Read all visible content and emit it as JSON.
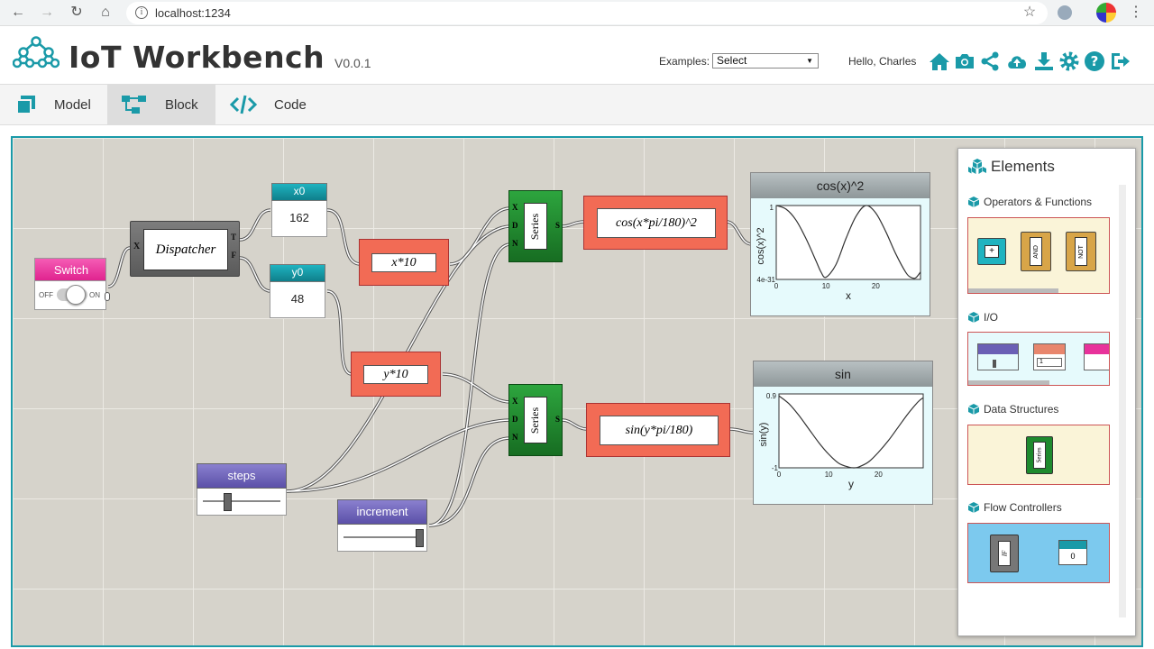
{
  "browser": {
    "url": "localhost:1234"
  },
  "header": {
    "title": "IoT Workbench",
    "version": "V0.0.1",
    "examples_label": "Examples:",
    "examples_selected": "Select",
    "greeting": "Hello, Charles"
  },
  "tabs": [
    {
      "label": "Model",
      "active": false
    },
    {
      "label": "Block",
      "active": true
    },
    {
      "label": "Code",
      "active": false
    }
  ],
  "nodes": {
    "switch": {
      "title": "Switch",
      "off": "OFF",
      "on": "ON"
    },
    "dispatcher": {
      "label": "Dispatcher",
      "in": "X",
      "out_t": "T",
      "out_f": "F"
    },
    "x0": {
      "title": "x0",
      "value": "162"
    },
    "y0": {
      "title": "y0",
      "value": "48"
    },
    "x10": {
      "expr": "x*10"
    },
    "y10": {
      "expr": "y*10"
    },
    "series1": {
      "label": "Series",
      "in_x": "X",
      "in_d": "D",
      "in_n": "N",
      "out": "S"
    },
    "series2": {
      "label": "Series",
      "in_x": "X",
      "in_d": "D",
      "in_n": "N",
      "out": "S"
    },
    "cosexpr": {
      "expr": "cos(x*pi/180)^2"
    },
    "sinexpr": {
      "expr": "sin(y*pi/180)"
    },
    "steps": {
      "title": "steps"
    },
    "increment": {
      "title": "increment"
    }
  },
  "charts_labels": {
    "cos": {
      "title": "cos(x)^2",
      "ylabel": "cos(x)^2",
      "xlabel": "x",
      "ytick_top": "1",
      "ytick_bottom": "4e-31",
      "xticks": [
        "0",
        "10",
        "20"
      ]
    },
    "sin": {
      "title": "sin",
      "ylabel": "sin(y)",
      "xlabel": "y",
      "ytick_top": "0.9",
      "ytick_bottom": "-1",
      "xticks": [
        "0",
        "10",
        "20"
      ]
    }
  },
  "chart_data": [
    {
      "type": "line",
      "title": "cos(x)^2",
      "xlabel": "x",
      "ylabel": "cos(x)^2",
      "xlim": [
        0,
        29
      ],
      "ylim": [
        0,
        1
      ],
      "series": [
        {
          "x": [
            0,
            2,
            4,
            6,
            8,
            9,
            10,
            12,
            14,
            16,
            18,
            20,
            22,
            24,
            26,
            27,
            28,
            29
          ],
          "y": [
            1,
            0.95,
            0.8,
            0.55,
            0.25,
            0.1,
            0.03,
            0.2,
            0.55,
            0.85,
            1,
            0.9,
            0.65,
            0.35,
            0.1,
            0.03,
            0.02,
            0.1
          ]
        }
      ]
    },
    {
      "type": "line",
      "title": "sin",
      "xlabel": "y",
      "ylabel": "sin(y)",
      "xlim": [
        0,
        29
      ],
      "ylim": [
        -1,
        0.9
      ],
      "series": [
        {
          "x": [
            0,
            2,
            4,
            6,
            8,
            10,
            12,
            14,
            15,
            16,
            18,
            20,
            22,
            24,
            26,
            28,
            29
          ],
          "y": [
            0.85,
            0.65,
            0.35,
            0.0,
            -0.35,
            -0.65,
            -0.88,
            -0.98,
            -1,
            -0.98,
            -0.85,
            -0.6,
            -0.3,
            0.05,
            0.4,
            0.7,
            0.8
          ]
        }
      ]
    }
  ],
  "elements_panel": {
    "title": "Elements",
    "sections": [
      "Operators & Functions",
      "I/O",
      "Data Structures",
      "Flow Controllers"
    ],
    "op_and": "AND",
    "op_not": "NOT",
    "op_plus": "+",
    "io_select": "1",
    "ds_series": "Series",
    "fc_if": "IF",
    "fc_zero": "0"
  },
  "colors": {
    "teal": "#1a9aa8",
    "pink": "#e8329b",
    "salmon": "#f26b55",
    "green": "#1e8a2e",
    "purple": "#6b5fb5",
    "gray_node": "#6a6a6a"
  }
}
